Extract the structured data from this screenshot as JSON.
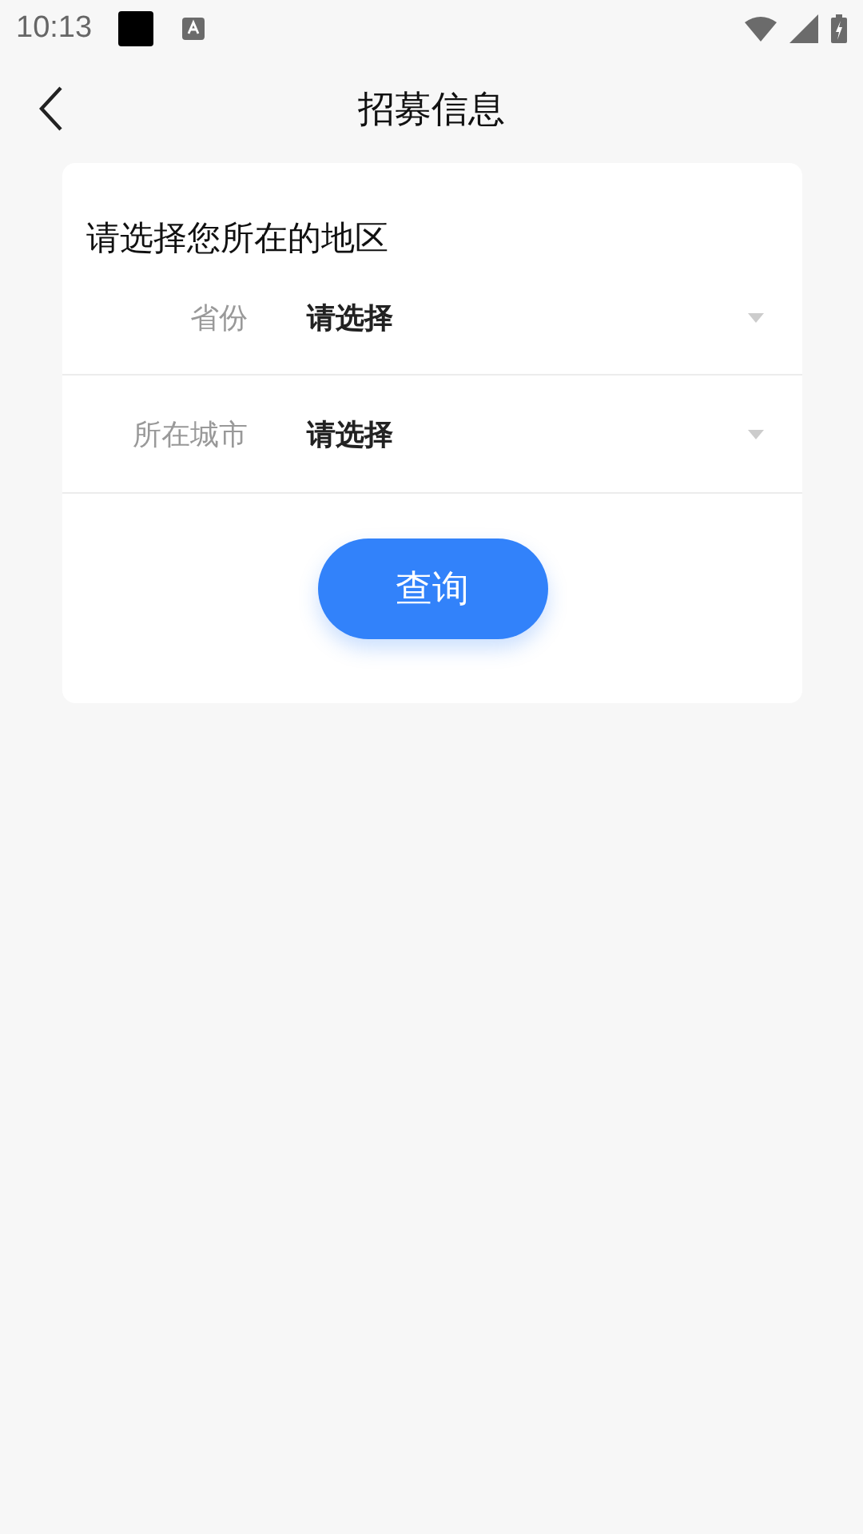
{
  "status_bar": {
    "time": "10:13"
  },
  "header": {
    "title": "招募信息"
  },
  "form": {
    "heading": "请选择您所在的地区",
    "fields": [
      {
        "label": "省份",
        "value": "请选择"
      },
      {
        "label": "所在城市",
        "value": "请选择"
      }
    ],
    "submit": "查询"
  }
}
